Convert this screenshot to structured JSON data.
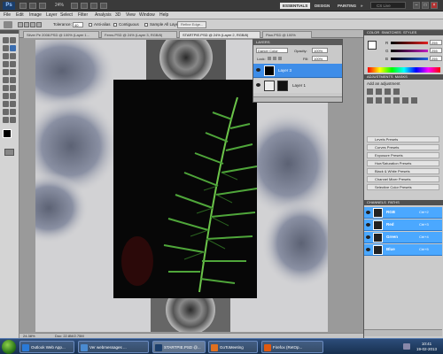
{
  "app_bar": {
    "logo": "Ps",
    "zoom": "24%",
    "workspaces": [
      "ESSENTIALS",
      "DESIGN",
      "PAINTING",
      "»"
    ],
    "cs_live": "CS Live",
    "window_controls": [
      "–",
      "□",
      "×"
    ]
  },
  "menu": [
    "File",
    "Edit",
    "Image",
    "Layer",
    "Select",
    "Filter",
    "Analysis",
    "3D",
    "View",
    "Window",
    "Help"
  ],
  "options": {
    "tolerance_label": "Tolerance:",
    "tolerance_value": "40",
    "anti_alias": "Anti-alias",
    "contiguous": "Contiguous",
    "sample_all": "Sample All Layers",
    "refine_edge": "Refine Edge..."
  },
  "doc_tabs": [
    "Silver Pe 2008.PSD @ 100% (Layer 1...",
    "Ferns.PSD @ 24% (Layer 3, RGB/8)",
    "STARTPIE.PSD @ 24% (Layer 2, RGB/8)",
    "Plan.PSD @ 100% (RGB/8)"
  ],
  "status": {
    "zoom": "24.38%",
    "doc": "Doc: 22.8M/2.75M"
  },
  "layers_panel": {
    "title": "LAYERS",
    "blend_mode": "Darker Color",
    "opacity_label": "Opacity:",
    "opacity": "100%",
    "lock_label": "Lock:",
    "fill_label": "Fill:",
    "fill": "100%",
    "layers": [
      "Layer 3",
      "Layer 1"
    ]
  },
  "color_panel": {
    "tabs": [
      "COLOR",
      "SWATCHES",
      "STYLES"
    ],
    "sliders": [
      {
        "channel": "R",
        "value": "255",
        "color": "#e02020"
      },
      {
        "channel": "G",
        "value": "255",
        "color": "#c020c0"
      },
      {
        "channel": "B",
        "value": "255",
        "color": "#2060e0"
      }
    ]
  },
  "adjustments_panel": {
    "tabs": [
      "ADJUSTMENTS",
      "MASKS"
    ],
    "subtitle": "Add an adjustment",
    "presets": [
      "Levels Presets",
      "Curves Presets",
      "Exposure Presets",
      "Hue/Saturation Presets",
      "Black & White Presets",
      "Channel Mixer Presets",
      "Selective Color Presets"
    ]
  },
  "channels_panel": {
    "tabs": [
      "CHANNELS",
      "PATHS"
    ],
    "channels": [
      {
        "name": "RGB",
        "shortcut": "Ctrl+2"
      },
      {
        "name": "Red",
        "shortcut": "Ctrl+3"
      },
      {
        "name": "Green",
        "shortcut": "Ctrl+4"
      },
      {
        "name": "Blue",
        "shortcut": "Ctrl+5"
      }
    ]
  },
  "taskbar": {
    "tasks": [
      {
        "label": "Outlook Web App...",
        "color": "#2a7ad8"
      },
      {
        "label": "Ver webmessages ...",
        "color": "#4a8ad0"
      },
      {
        "label": "STARTPIE.PSD @...",
        "color": "#1b3e6b"
      },
      {
        "label": "GoToMeeting",
        "color": "#e07020"
      },
      {
        "label": "Firefox (RetOp...",
        "color": "#e05a10"
      }
    ],
    "time": "10:41",
    "date": "19-02-2013"
  }
}
